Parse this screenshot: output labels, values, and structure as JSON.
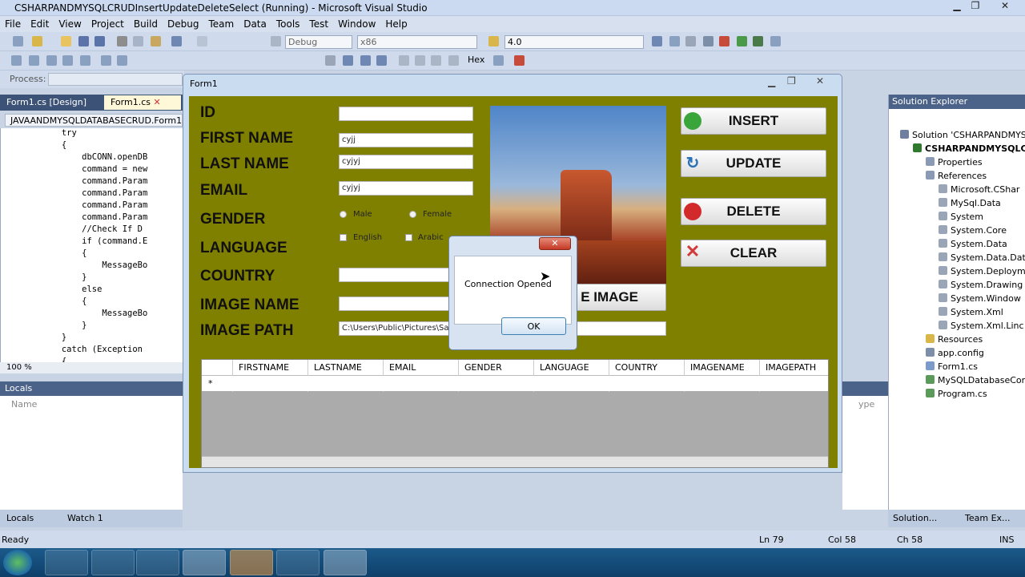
{
  "window": {
    "title": "CSHARPANDMYSQLCRUDInsertUpdateDeleteSelect (Running) - Microsoft Visual Studio"
  },
  "menu": [
    "File",
    "Edit",
    "View",
    "Project",
    "Build",
    "Debug",
    "Team",
    "Data",
    "Tools",
    "Test",
    "Window",
    "Help"
  ],
  "toolbar": {
    "config": "Debug",
    "platform": "x86",
    "framework": "4.0",
    "hex": "Hex",
    "process_label": "Process:"
  },
  "doctabs": {
    "design": "Form1.cs [Design]",
    "code": "Form1.cs",
    "class_combo": "JAVAANDMYSQLDATABASECRUD.Form1"
  },
  "code_lines": [
    {
      "text": "            try",
      "cls": "kw"
    },
    {
      "text": "            {",
      "cls": ""
    },
    {
      "text": "                dbCONN.openDB",
      "cls": ""
    },
    {
      "text": "                command = new",
      "cls": ""
    },
    {
      "text": "                command.Param",
      "cls": ""
    },
    {
      "text": "                command.Param",
      "cls": ""
    },
    {
      "text": "                command.Param",
      "cls": ""
    },
    {
      "text": "                command.Param",
      "cls": ""
    },
    {
      "text": "                //Check If D",
      "cls": "cm"
    },
    {
      "text": "                if (command.E",
      "cls": ""
    },
    {
      "text": "                {",
      "cls": ""
    },
    {
      "text": "                    MessageBo",
      "cls": "cl"
    },
    {
      "text": "                }",
      "cls": ""
    },
    {
      "text": "                else",
      "cls": "kw"
    },
    {
      "text": "                {",
      "cls": ""
    },
    {
      "text": "                    MessageBo",
      "cls": "cl"
    },
    {
      "text": "                }",
      "cls": ""
    },
    {
      "text": "            }",
      "cls": ""
    },
    {
      "text": "            catch (Exception",
      "cls": ""
    },
    {
      "text": "            {",
      "cls": ""
    }
  ],
  "zoom": "100 %",
  "locals": {
    "title": "Locals",
    "col_name": "Name",
    "col_type": "ype"
  },
  "bottom_tabs": {
    "locals": "Locals",
    "watch": "Watch 1"
  },
  "status": {
    "ready": "Ready",
    "ln": "Ln 79",
    "col": "Col 58",
    "ch": "Ch 58",
    "ins": "INS"
  },
  "solution_explorer": {
    "title": "Solution Explorer",
    "items": [
      {
        "label": "Solution 'CSHARPANDMYS",
        "indent": 0,
        "color": "#6e7fa0"
      },
      {
        "label": "CSHARPANDMYSQLCI",
        "indent": 1,
        "color": "#2f7a2f",
        "bold": true
      },
      {
        "label": "Properties",
        "indent": 2,
        "color": "#8a9ab5"
      },
      {
        "label": "References",
        "indent": 2,
        "color": "#8a9ab5"
      },
      {
        "label": "Microsoft.CShar",
        "indent": 3,
        "color": "#9aa6b8"
      },
      {
        "label": "MySql.Data",
        "indent": 3,
        "color": "#9aa6b8"
      },
      {
        "label": "System",
        "indent": 3,
        "color": "#9aa6b8"
      },
      {
        "label": "System.Core",
        "indent": 3,
        "color": "#9aa6b8"
      },
      {
        "label": "System.Data",
        "indent": 3,
        "color": "#9aa6b8"
      },
      {
        "label": "System.Data.Dat",
        "indent": 3,
        "color": "#9aa6b8"
      },
      {
        "label": "System.Deploym",
        "indent": 3,
        "color": "#9aa6b8"
      },
      {
        "label": "System.Drawing",
        "indent": 3,
        "color": "#9aa6b8"
      },
      {
        "label": "System.Window",
        "indent": 3,
        "color": "#9aa6b8"
      },
      {
        "label": "System.Xml",
        "indent": 3,
        "color": "#9aa6b8"
      },
      {
        "label": "System.Xml.Linc",
        "indent": 3,
        "color": "#9aa6b8"
      },
      {
        "label": "Resources",
        "indent": 2,
        "color": "#d9b64a"
      },
      {
        "label": "app.config",
        "indent": 2,
        "color": "#7d8ea8"
      },
      {
        "label": "Form1.cs",
        "indent": 2,
        "color": "#7d9bc8"
      },
      {
        "label": "MySQLDatabaseCor",
        "indent": 2,
        "color": "#5b9a5b"
      },
      {
        "label": "Program.cs",
        "indent": 2,
        "color": "#5b9a5b"
      }
    ],
    "tab_solution": "Solution...",
    "tab_team": "Team Ex..."
  },
  "form": {
    "title": "Form1",
    "labels": {
      "id": "ID",
      "first": "FIRST NAME",
      "last": "LAST NAME",
      "email": "EMAIL",
      "gender": "GENDER",
      "language": "LANGUAGE",
      "country": "COUNTRY",
      "image_name": "IMAGE NAME",
      "image_path": "IMAGE PATH"
    },
    "values": {
      "id": "",
      "first": "cyjj",
      "last": "cyjyj",
      "email": "cyjyj",
      "country": "",
      "image_name": "",
      "image_path": "C:\\Users\\Public\\Pictures\\Sam"
    },
    "gender_options": [
      "Male",
      "Female"
    ],
    "language_options": [
      "English",
      "Arabic"
    ],
    "buttons": {
      "insert": "INSERT",
      "update": "UPDATE",
      "delete": "DELETE",
      "clear": "CLEAR",
      "choose_image": "E IMAGE"
    },
    "grid_columns": [
      "FIRSTNAME",
      "LASTNAME",
      "EMAIL",
      "GENDER",
      "LANGUAGE",
      "COUNTRY",
      "IMAGENAME",
      "IMAGEPATH"
    ],
    "new_row_marker": "*"
  },
  "dialog": {
    "message": "Connection Opened",
    "ok": "OK",
    "close": "✕"
  },
  "colors": {
    "form_bg": "#808000",
    "vs_chrome": "#cfdbec",
    "dialog_border": "#6d85ad"
  }
}
